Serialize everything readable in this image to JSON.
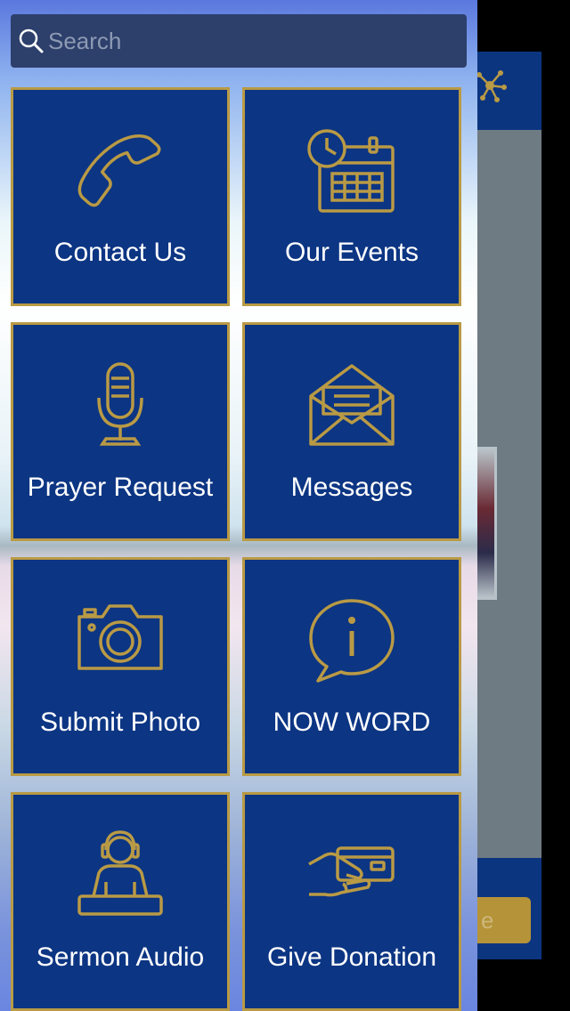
{
  "search": {
    "placeholder": "Search",
    "icon": "search-icon"
  },
  "menu": {
    "accent_color": "#b99a45",
    "tile_color": "#0c3583",
    "items": [
      {
        "label": "Contact Us",
        "icon": "phone-icon"
      },
      {
        "label": "Our Events",
        "icon": "calendar-clock-icon"
      },
      {
        "label": "Prayer Request",
        "icon": "microphone-icon"
      },
      {
        "label": "Messages",
        "icon": "envelope-icon"
      },
      {
        "label": "Submit Photo",
        "icon": "camera-icon"
      },
      {
        "label": "NOW WORD",
        "icon": "info-bubble-icon"
      },
      {
        "label": "Sermon Audio",
        "icon": "headphones-person-icon"
      },
      {
        "label": "Give Donation",
        "icon": "hand-card-icon"
      }
    ]
  },
  "background_app": {
    "button_text": "e"
  }
}
